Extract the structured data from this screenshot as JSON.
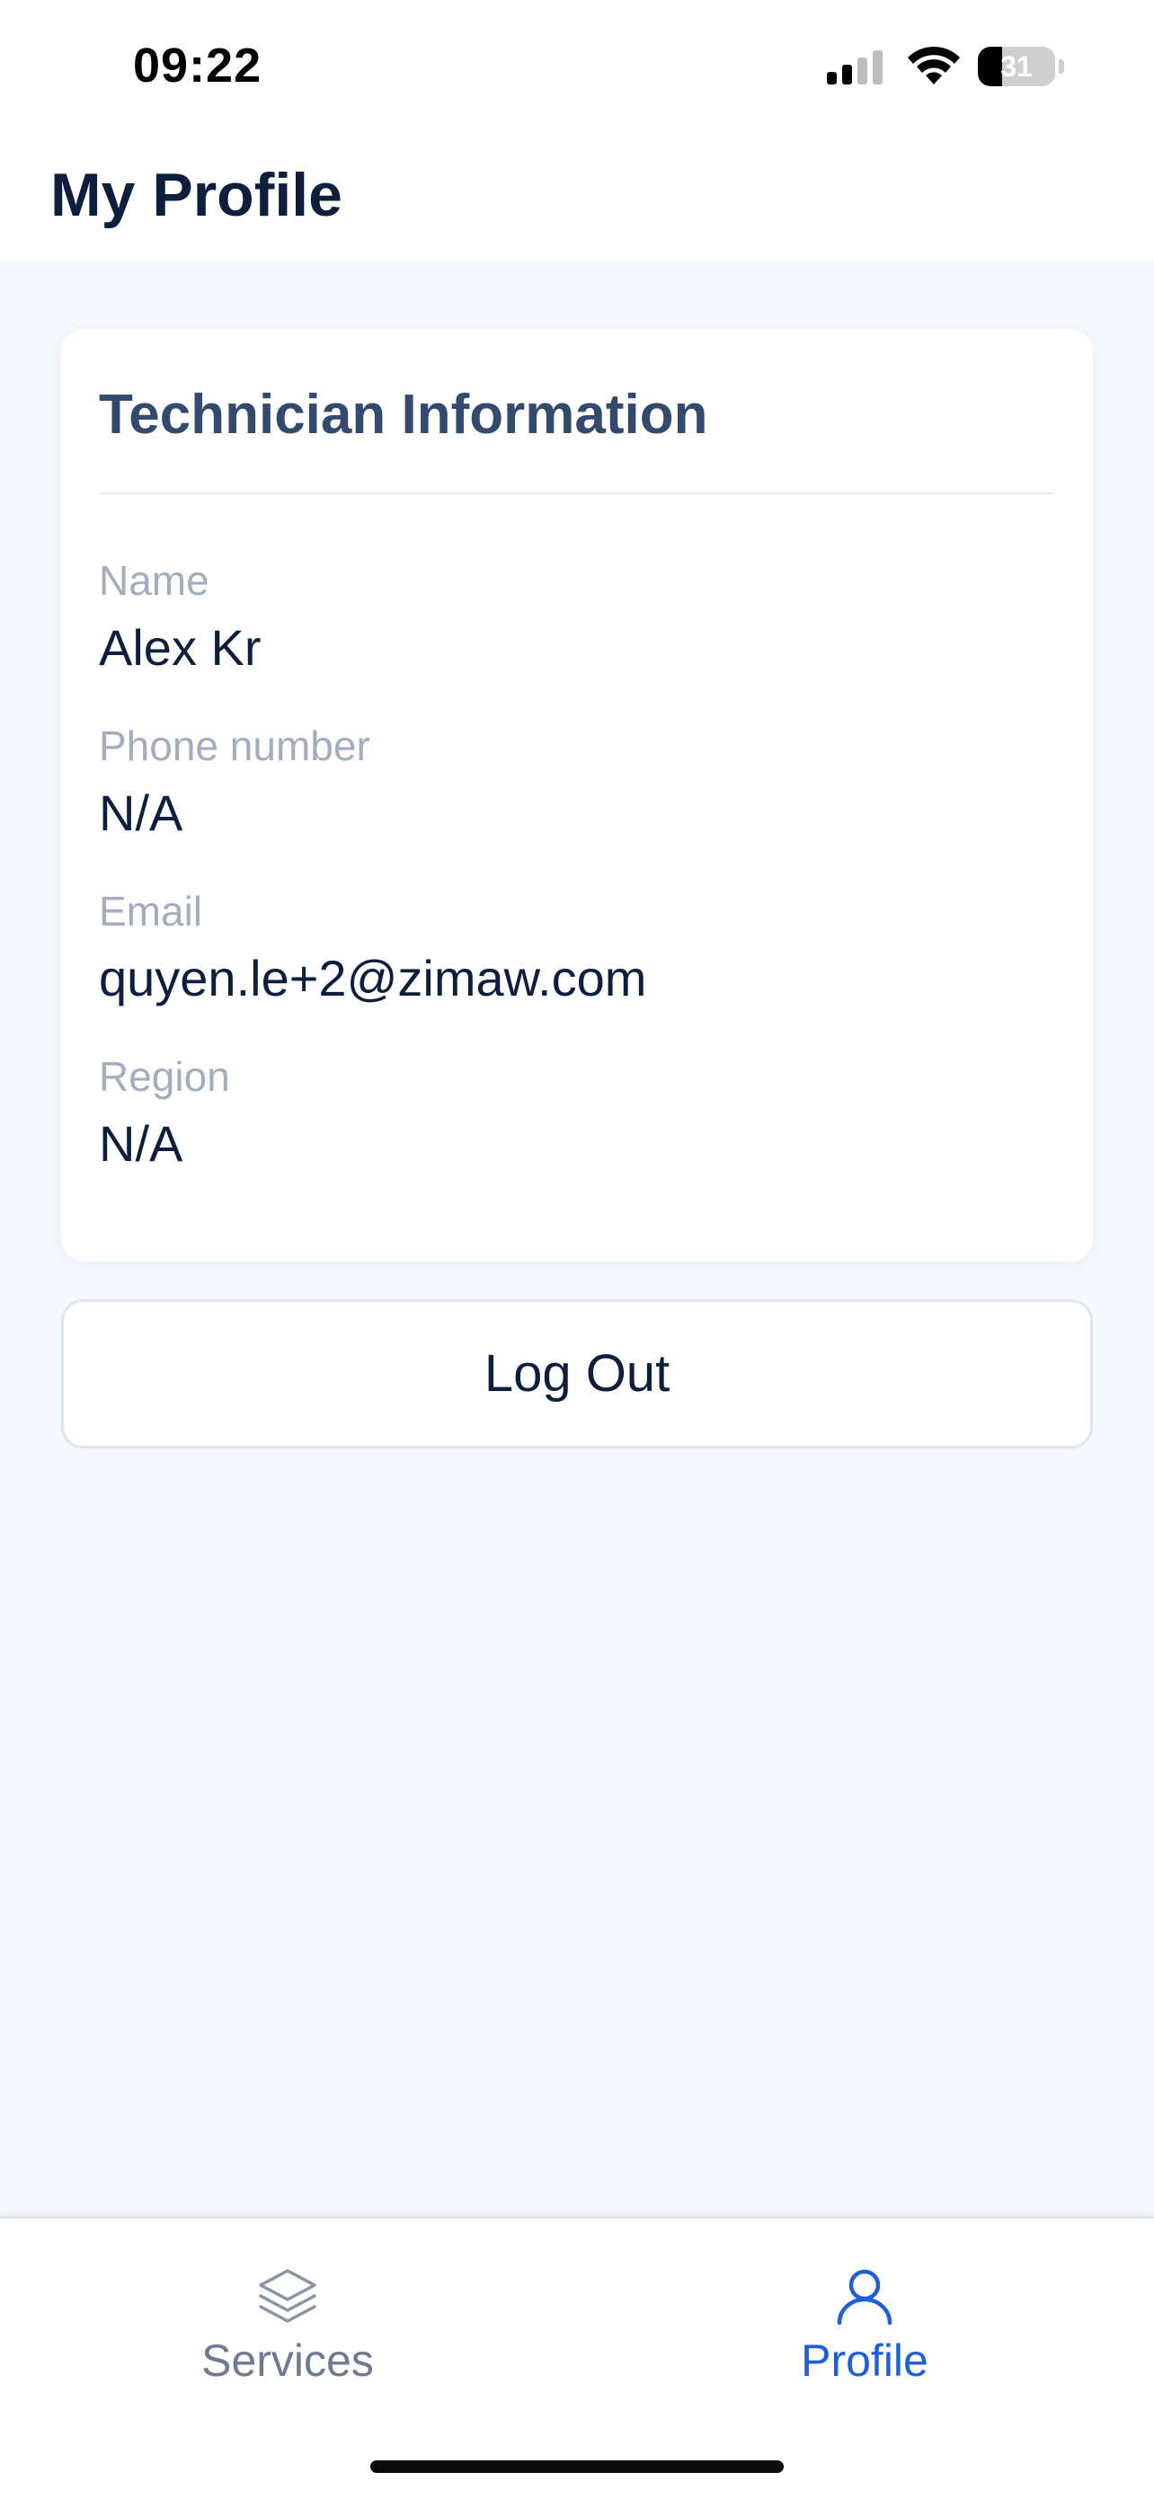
{
  "status_bar": {
    "time": "09:22",
    "battery_level": "31",
    "battery_fraction": 0.31,
    "icons": [
      "signal-icon",
      "wifi-icon",
      "battery-icon"
    ]
  },
  "header": {
    "title": "My Profile"
  },
  "technician_card": {
    "title": "Technician Information",
    "fields": [
      {
        "label": "Name",
        "value": "Alex Kr"
      },
      {
        "label": "Phone number",
        "value": "N/A"
      },
      {
        "label": "Email",
        "value": "quyen.le+2@zimaw.com"
      },
      {
        "label": "Region",
        "value": "N/A"
      }
    ]
  },
  "actions": {
    "logout_label": "Log Out"
  },
  "tab_bar": {
    "tabs": [
      {
        "label": "Services",
        "icon": "layers-icon",
        "active": false
      },
      {
        "label": "Profile",
        "icon": "user-icon",
        "active": true
      }
    ]
  },
  "colors": {
    "accent": "#1f5fd6",
    "title": "#0e1f3d",
    "card_title": "#33496e",
    "label": "#a3adbd",
    "background": "#f5f9fd"
  }
}
